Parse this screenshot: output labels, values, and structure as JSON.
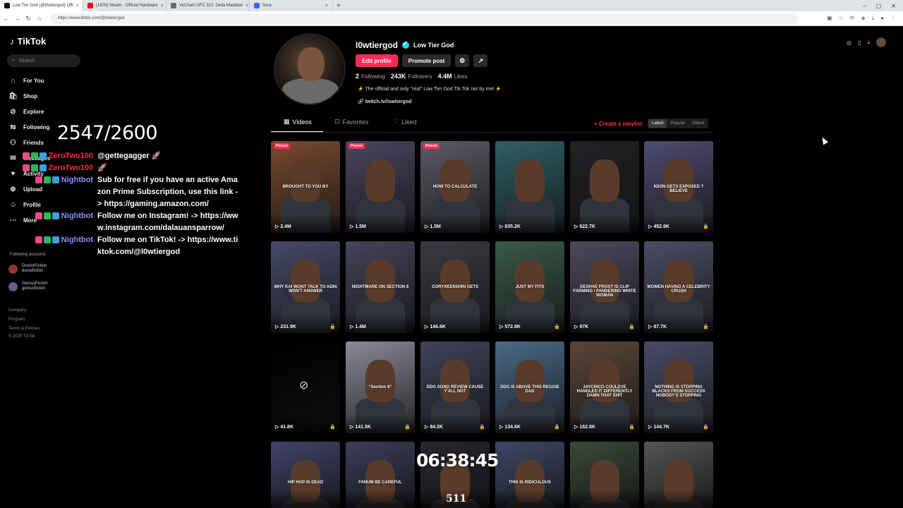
{
  "browser": {
    "tabs": [
      {
        "title": "Low Tier God (@l0wtiergod) Offi",
        "color": "#111111",
        "active": true
      },
      {
        "title": "(1876) Steam - Official Hardware",
        "color": "#ff0000",
        "active": false
      },
      {
        "title": "VeChain UFC 322: Della Maddalo",
        "color": "#6b6b6b",
        "active": false
      },
      {
        "title": "Sora",
        "color": "#2a6df4",
        "active": false
      }
    ],
    "url": "https://www.tiktok.com/@l0wtiergod"
  },
  "sidebar": {
    "logo": "TikTok",
    "search_placeholder": "Search",
    "items": [
      {
        "label": "For You",
        "icon": "home-icon"
      },
      {
        "label": "Shop",
        "icon": "shop-icon"
      },
      {
        "label": "Explore",
        "icon": "compass-icon"
      },
      {
        "label": "Following",
        "icon": "following-icon"
      },
      {
        "label": "Friends",
        "icon": "friends-icon"
      },
      {
        "label": "Messages",
        "icon": "messages-icon"
      },
      {
        "label": "Activity",
        "icon": "activity-icon"
      },
      {
        "label": "Upload",
        "icon": "upload-icon"
      },
      {
        "label": "Profile",
        "icon": "profile-icon"
      },
      {
        "label": "More",
        "icon": "more-icon"
      }
    ],
    "following_accounts_label": "Following accounts",
    "accounts": [
      {
        "name": "DoctorFiction",
        "handle": "doctafiction"
      },
      {
        "name": "GeniusFiction",
        "handle": "geniusfiction"
      }
    ],
    "footer": [
      "Company",
      "Program",
      "Terms & Policies",
      "© 2025 TikTok"
    ]
  },
  "overlay": {
    "counter": "2547/2600",
    "chat": [
      {
        "user": "ZeroTwo100",
        "bot": false,
        "message": "@gettegagger 🚀"
      },
      {
        "user": "ZeroTwo100",
        "bot": false,
        "message": "🚀"
      },
      {
        "user": "Nightbot",
        "bot": true,
        "message": "Sub for free if you have an active Amazon Prime Subscription, use this link -> https://gaming.amazon.com/"
      },
      {
        "user": "Nightbot",
        "bot": true,
        "message": "Follow me on Instagram! -> https://www.instagram.com/dalauansparrow/"
      },
      {
        "user": "Nightbot",
        "bot": true,
        "message": "Follow me on TikTok! -> https://www.tiktok.com/@l0wtiergod"
      }
    ],
    "timer": "06:38:45",
    "timer_sub": "511"
  },
  "profile": {
    "username": "l0wtiergod",
    "display_name": "Low Tier God",
    "edit_label": "Edit profile",
    "promote_label": "Promote post",
    "following_count": "2",
    "following_label": "Following",
    "followers_count": "243K",
    "followers_label": "Followers",
    "likes_count": "4.4M",
    "likes_label": "Likes",
    "bio": "⚡ The official and only \"real\" Low Tier God Tik Tok ran by me! ⚡",
    "link": "twitch.tv/lowtiergod"
  },
  "tabs": {
    "videos": "Videos",
    "favorites": "Favorites",
    "liked": "Liked",
    "create_playlist": "+ Create a playlist",
    "sort": [
      "Latest",
      "Popular",
      "Oldest"
    ]
  },
  "videos": [
    {
      "views": "2.4M",
      "pinned": true,
      "caption": "BROUGHT TO YOU BY",
      "bg": "#7a4a2e",
      "lock": false
    },
    {
      "views": "1.5M",
      "pinned": true,
      "caption": "",
      "bg": "#4a4560",
      "lock": false
    },
    {
      "views": "1.5M",
      "pinned": true,
      "caption": "HOW TO CALCULATE",
      "bg": "#5b5b66",
      "lock": false
    },
    {
      "views": "835.2K",
      "pinned": false,
      "caption": "",
      "bg": "#2f5f66",
      "lock": false
    },
    {
      "views": "622.7K",
      "pinned": false,
      "caption": "",
      "bg": "#222226",
      "lock": false
    },
    {
      "views": "452.8K",
      "pinned": false,
      "caption": "N3ON GETS EXPOSED ? BELIEVE",
      "bg": "#4f4c70",
      "lock": true
    },
    {
      "views": "231.9K",
      "pinned": false,
      "caption": "WHY KAI WONT TALK TO ADIN WON'T ANSWER",
      "bg": "#464a68",
      "lock": true
    },
    {
      "views": "1.4M",
      "pinned": false,
      "caption": "NIGHTMARE ON SECTION 8",
      "bg": "#47435a",
      "lock": false
    },
    {
      "views": "146.6K",
      "pinned": false,
      "caption": "CORYXKENSHIN GETS",
      "bg": "#3d3a44",
      "lock": false
    },
    {
      "views": "572.8K",
      "pinned": false,
      "caption": "JUST MY FITS",
      "bg": "#3a5a4a",
      "lock": true
    },
    {
      "views": "97K",
      "pinned": false,
      "caption": "DESHAE FROST IS CLIP FARMING / PANDERING WHITE WOMAN",
      "bg": "#4a4a5e",
      "lock": true
    },
    {
      "views": "87.7K",
      "pinned": false,
      "caption": "WOMEN HAVING A CELEBRITY CRUSH",
      "bg": "#4c4d66",
      "lock": true
    },
    {
      "views": "41.8K",
      "pinned": false,
      "caption": "",
      "bg": "#000000",
      "lock": true,
      "hidden": true
    },
    {
      "views": "141.5K",
      "pinned": false,
      "caption": "\"Section 8\"",
      "bg": "#8a8a99",
      "lock": true
    },
    {
      "views": "84.3K",
      "pinned": false,
      "caption": "DDG SONG REVIEW CAUSE Y'ALL NOT",
      "bg": "#40435a",
      "lock": true
    },
    {
      "views": "134.6K",
      "pinned": false,
      "caption": "DDG IS ABOVE THIS REGGIE DAD",
      "bg": "#4a6a88",
      "lock": true
    },
    {
      "views": "162.8K",
      "pinned": false,
      "caption": "JAYCINCO COULDVE HANDLED IT DIFFERENTLY DAMN THAT SHIT",
      "bg": "#5a463a",
      "lock": true
    },
    {
      "views": "144.7K",
      "pinned": false,
      "caption": "NOTHING IS STOPPING BLACKS FROM SUCCESS NOBODY'S STOPPING",
      "bg": "#4a4c68",
      "lock": true
    },
    {
      "views": "",
      "pinned": false,
      "caption": "HIP HOP IS DEAD",
      "bg": "#41446a",
      "lock": false
    },
    {
      "views": "",
      "pinned": false,
      "caption": "FANUM BE CAREFUL",
      "bg": "#3c3e58",
      "lock": false
    },
    {
      "views": "",
      "pinned": false,
      "caption": "",
      "bg": "#2b2630",
      "lock": false
    },
    {
      "views": "",
      "pinned": false,
      "caption": "THIS IS RIDICULOUS",
      "bg": "#3f4868",
      "lock": false
    },
    {
      "views": "",
      "pinned": false,
      "caption": "",
      "bg": "#3a4a3a",
      "lock": false
    },
    {
      "views": "",
      "pinned": false,
      "caption": "",
      "bg": "#555558",
      "lock": false
    }
  ]
}
